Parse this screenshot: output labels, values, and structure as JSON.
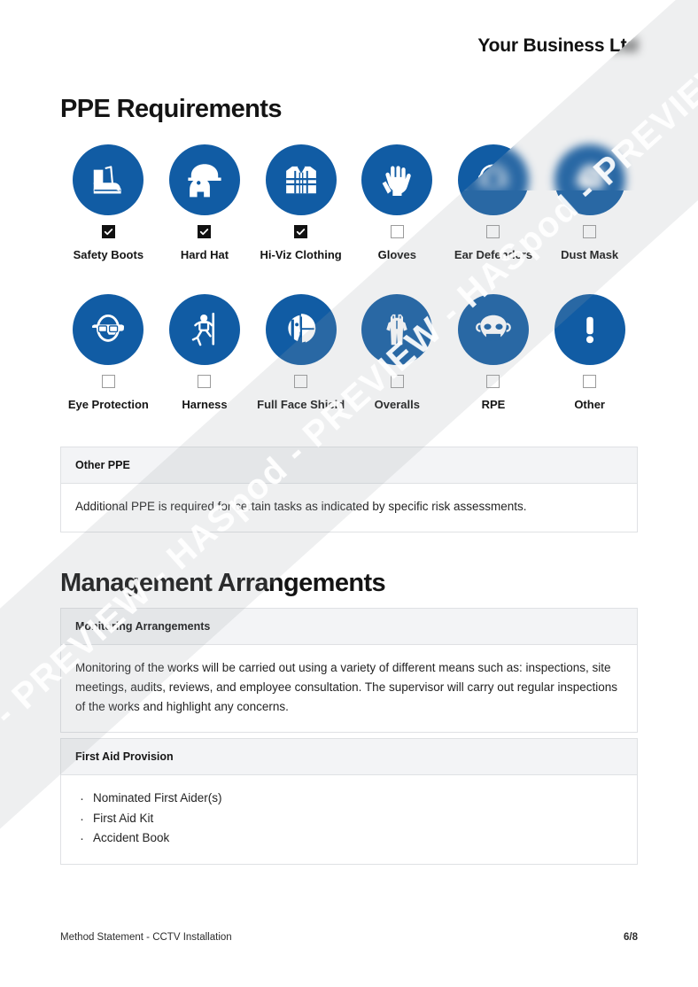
{
  "header": {
    "company_name": "Your Business Ltd"
  },
  "sections": {
    "ppe_heading": "PPE Requirements",
    "management_heading": "Management Arrangements"
  },
  "ppe_items": [
    {
      "label": "Safety Boots",
      "icon": "safety-boots-icon",
      "checked": true
    },
    {
      "label": "Hard Hat",
      "icon": "hard-hat-icon",
      "checked": true
    },
    {
      "label": "Hi-Viz Clothing",
      "icon": "hi-viz-icon",
      "checked": true
    },
    {
      "label": "Gloves",
      "icon": "gloves-icon",
      "checked": false
    },
    {
      "label": "Ear Defenders",
      "icon": "ear-defenders-icon",
      "checked": false
    },
    {
      "label": "Dust Mask",
      "icon": "dust-mask-icon",
      "checked": false
    },
    {
      "label": "Eye Protection",
      "icon": "eye-protection-icon",
      "checked": false
    },
    {
      "label": "Harness",
      "icon": "harness-icon",
      "checked": false
    },
    {
      "label": "Full Face Shield",
      "icon": "face-shield-icon",
      "checked": false
    },
    {
      "label": "Overalls",
      "icon": "overalls-icon",
      "checked": false
    },
    {
      "label": "RPE",
      "icon": "rpe-icon",
      "checked": false
    },
    {
      "label": "Other",
      "icon": "exclamation-icon",
      "checked": false
    }
  ],
  "boxes": {
    "other_ppe": {
      "title": "Other PPE",
      "body": "Additional PPE is required for certain tasks as indicated by specific risk assessments."
    },
    "monitoring": {
      "title": "Monitoring Arrangements",
      "body": "Monitoring of the works will be carried out using a variety of different means such as: inspections, site meetings, audits, reviews, and employee consultation. The supervisor will carry out regular inspections of the works and highlight any concerns."
    },
    "first_aid": {
      "title": "First Aid Provision",
      "items": [
        "Nominated First Aider(s)",
        "First Aid Kit",
        "Accident Book"
      ]
    }
  },
  "footer": {
    "document_title": "Method Statement - CCTV Installation",
    "page_number": "6/8"
  },
  "watermark": {
    "text": "HASpod - PREVIEW - HASpod - PREVIEW - HASpod - PREVIEW - HASpod - PREVIEW - HASpod - PREVIEW - "
  },
  "colors": {
    "ppe_blue": "#115CA4",
    "box_header_bg": "#f3f4f6",
    "box_border": "#dfe1e4"
  }
}
